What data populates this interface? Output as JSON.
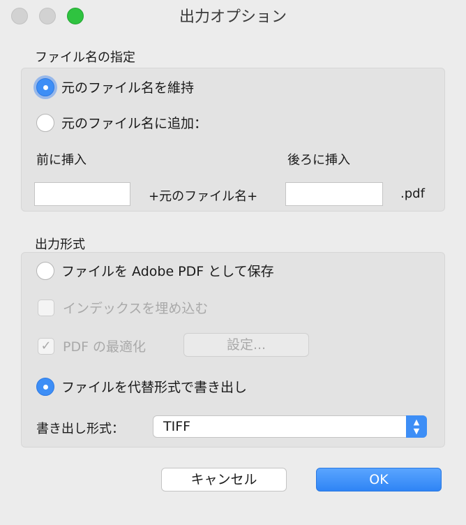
{
  "window": {
    "title": "出力オプション"
  },
  "filename": {
    "section_label": "ファイル名の指定",
    "keep_original": {
      "label": "元のファイル名を維持",
      "selected": true
    },
    "add_to_original": {
      "label": "元のファイル名に追加：",
      "selected": false
    },
    "prefix_label": "前に挿入",
    "prefix_value": "",
    "suffix_label": "後ろに挿入",
    "suffix_value": "",
    "middle_text": "+元のファイル名+",
    "extension_text": ".pdf"
  },
  "output": {
    "section_label": "出力形式",
    "save_as_pdf": {
      "label": "ファイルを Adobe PDF として保存",
      "selected": false
    },
    "embed_index": {
      "label": "インデックスを埋め込む",
      "checked": false,
      "enabled": false
    },
    "optimize_pdf": {
      "label": "PDF の最適化",
      "checked": true,
      "enabled": false
    },
    "settings_button": "設定...",
    "export_alternate": {
      "label": "ファイルを代替形式で書き出し",
      "selected": true
    },
    "format_label": "書き出し形式：",
    "format_value": "TIFF"
  },
  "footer": {
    "cancel_label": "キャンセル",
    "ok_label": "OK"
  },
  "colors": {
    "accent": "#3d8ef6",
    "maximize": "#2fc340"
  },
  "icons": {
    "check": "checkmark-icon",
    "stepper": "up-down-chevron-icon"
  }
}
